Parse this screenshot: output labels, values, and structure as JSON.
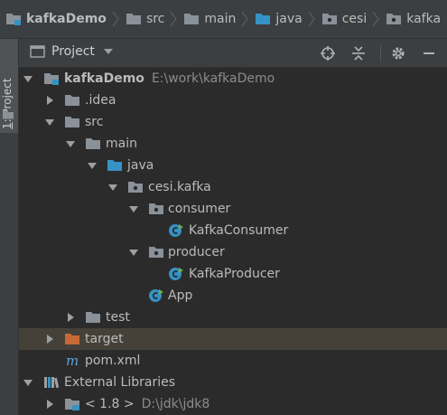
{
  "breadcrumb": [
    {
      "label": "kafkaDemo",
      "icon": "module-folder-icon"
    },
    {
      "label": "src",
      "icon": "folder-icon"
    },
    {
      "label": "main",
      "icon": "folder-icon"
    },
    {
      "label": "java",
      "icon": "source-folder-icon"
    },
    {
      "label": "cesi",
      "icon": "package-icon"
    },
    {
      "label": "kafka",
      "icon": "package-icon"
    }
  ],
  "side_tab": {
    "number": "1",
    "label": ": Project"
  },
  "toolwindow": {
    "title": "Project"
  },
  "tree": {
    "root_label": "kafkaDemo",
    "root_path": "E:\\work\\kafkaDemo",
    "idea": ".idea",
    "src": "src",
    "main": "main",
    "java": "java",
    "pkg": "cesi.kafka",
    "consumer": "consumer",
    "kafka_consumer": "KafkaConsumer",
    "producer": "producer",
    "kafka_producer": "KafkaProducer",
    "app": "App",
    "test": "test",
    "target": "target",
    "pom": "pom.xml",
    "ext_libs": "External Libraries",
    "jdk_label": "< 1.8 >",
    "jdk_path": "D:\\jdk\\jdk8"
  },
  "colors": {
    "accent": "#3592c4",
    "folder": "#8a9199",
    "target_folder": "#c56a36"
  }
}
